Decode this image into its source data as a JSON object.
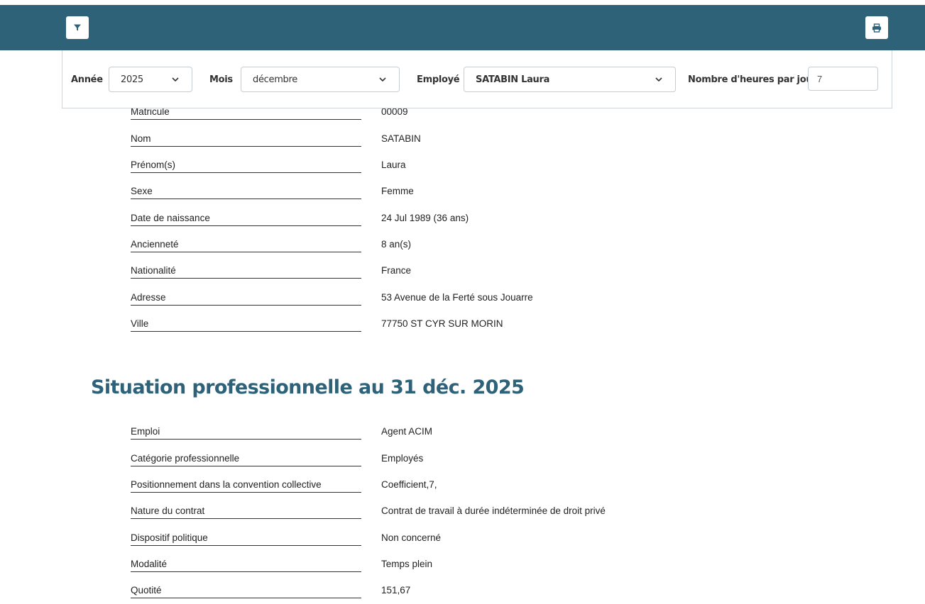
{
  "filters": {
    "year_label": "Année",
    "year_value": "2025",
    "month_label": "Mois",
    "month_value": "décembre",
    "employee_label": "Employé",
    "employee_value": "SATABIN Laura",
    "hours_label": "Nombre d'heures par jour",
    "hours_value": "7"
  },
  "identity": [
    {
      "label": "Matricule",
      "value": "00009"
    },
    {
      "label": "Nom",
      "value": "SATABIN"
    },
    {
      "label": "Prénom(s)",
      "value": "Laura"
    },
    {
      "label": "Sexe",
      "value": "Femme"
    },
    {
      "label": "Date de naissance",
      "value": "24 Jul 1989 (36 ans)"
    },
    {
      "label": "Ancienneté",
      "value": "8 an(s)"
    },
    {
      "label": "Nationalité",
      "value": "France"
    },
    {
      "label": "Adresse",
      "value": "53 Avenue de la Ferté sous Jouarre"
    },
    {
      "label": "Ville",
      "value": "77750 ST CYR SUR MORIN"
    }
  ],
  "situation": {
    "title": "Situation professionnelle au 31 déc. 2025",
    "rows": [
      {
        "label": "Emploi",
        "value": "Agent ACIM"
      },
      {
        "label": "Catégorie professionnelle",
        "value": "Employés"
      },
      {
        "label": "Positionnement dans la convention collective",
        "value": "Coefficient,7,"
      },
      {
        "label": "Nature du contrat",
        "value": "Contrat de travail à durée indéterminée de droit privé"
      },
      {
        "label": "Dispositif politique",
        "value": "Non concerné"
      },
      {
        "label": "Modalité",
        "value": "Temps plein"
      },
      {
        "label": "Quotité",
        "value": "151,67"
      }
    ]
  },
  "colors": {
    "header": "#2d6279",
    "title": "#2d6279"
  },
  "icons": {
    "filter": "filter-icon",
    "print": "print-icon"
  }
}
